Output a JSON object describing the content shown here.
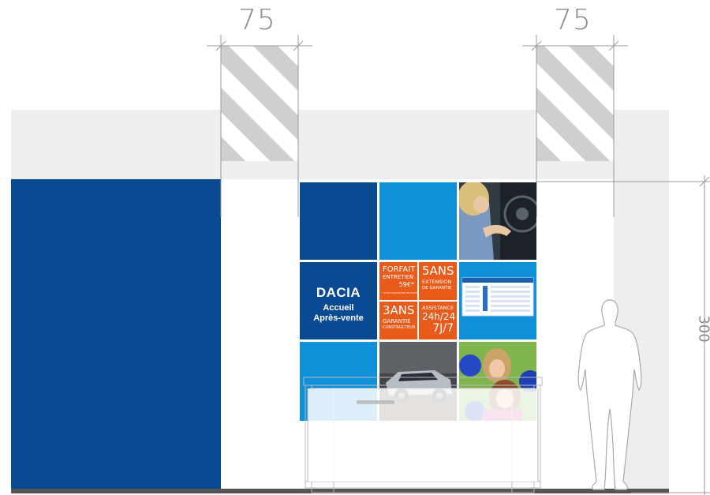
{
  "dimensions": {
    "left_width": "75",
    "right_width": "75",
    "height": "300"
  },
  "panel": {
    "logo_text": "DACIA",
    "subtitle_line1": "Accueil",
    "subtitle_line2": "Après-vente",
    "offers": {
      "forfait_line1": "FORFAIT",
      "forfait_line2": "ENTRETIEN",
      "forfait_price": "59€*",
      "forfait_fine_print": "*VOIR CONDITIONS EN ATELIER",
      "extension_big": "5ANS",
      "extension_line1": "EXTENSION",
      "extension_line2": "DE GARANTIE",
      "garantie_big": "3ANS",
      "garantie_line1": "GARANTIE",
      "garantie_line2": "CONSTRUCTEUR",
      "assistance_line1": "ASSISTANCE",
      "assistance_line2": "24h/24",
      "assistance_line3": "7J/7"
    }
  },
  "colors": {
    "dacia_blue": "#0a4a93",
    "light_blue": "#0f90d8",
    "orange": "#e85b1a",
    "soffit_grey": "#eeeeee",
    "hatch_grey": "#cfcfcf",
    "floor": "#555555"
  },
  "images": [
    "woman-at-car-photo",
    "price-table-screen",
    "suv-offroad-photo",
    "happy-women-balloons-photo"
  ]
}
